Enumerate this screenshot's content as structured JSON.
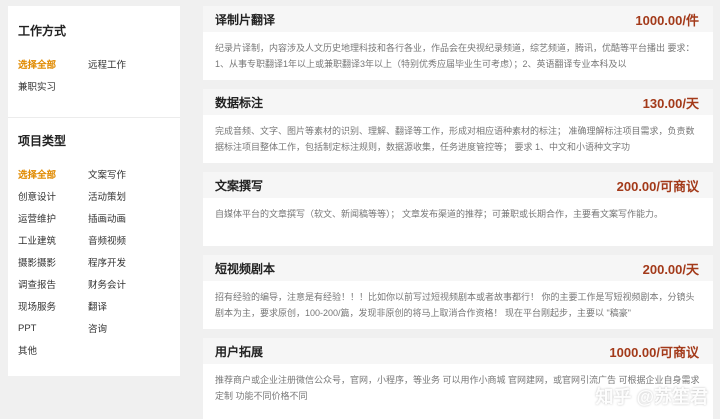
{
  "sidebar": {
    "work_mode": {
      "title": "工作方式",
      "rows": [
        [
          "选择全部",
          "远程工作"
        ],
        [
          "兼职实习"
        ]
      ]
    },
    "project_type": {
      "title": "项目类型",
      "rows": [
        [
          "选择全部",
          "文案写作"
        ],
        [
          "创意设计",
          "活动策划"
        ],
        [
          "运营维护",
          "插画动画"
        ],
        [
          "工业建筑",
          "音频视频"
        ],
        [
          "摄影摄影",
          "程序开发"
        ],
        [
          "调查报告",
          "财务会计"
        ],
        [
          "现场服务",
          "翻译"
        ],
        [
          "PPT",
          "咨询"
        ],
        [
          "其他"
        ]
      ]
    }
  },
  "jobs": [
    {
      "title": "译制片翻译",
      "price": "1000.00/件",
      "desc": "纪录片译制，内容涉及人文历史地理科技和各行各业，作品会在央视纪录频道，综艺频道，腾讯，优酷等平台播出 要求： 1、从事专职翻译1年以上或兼职翻译3年以上（特别优秀应届毕业生可考虑）；2、英语翻译专业本科及以"
    },
    {
      "title": "数据标注",
      "price": "130.00/天",
      "desc": "完成音频、文字、图片等素材的识别、理解、翻译等工作，形成对相应语种素材的标注； 准确理解标注项目需求，负责数据标注项目整体工作，包括制定标注规则，数据源收集，任务进度管控等； 要求 1、中文和小语种文字功"
    },
    {
      "title": "文案撰写",
      "price": "200.00/可商议",
      "desc": "自媒体平台的文章撰写（软文、新闻稿等等）； 文章发布渠道的推荐；可兼职或长期合作，主要看文案写作能力。"
    },
    {
      "title": "短视频剧本",
      "price": "200.00/天",
      "desc": "招有经验的编导，注意是有经验！！！比如你以前写过短视频剧本或者故事都行！ 你的主要工作是写短视频剧本，分镜头剧本为主，要求原创，100-200/篇，发现非原创的将马上取消合作资格！ 现在平台刚起步，主要以 \"稿豪\""
    },
    {
      "title": "用户拓展",
      "price": "1000.00/可商议",
      "desc": "推荐商户或企业注册微信公众号，官网，小程序，等业务 可以用作小商城 官网建网，或官网引流广告 可根据企业自身需求定制 功能不同价格不同"
    }
  ],
  "watermark": "知乎 @苏笙君",
  "colors": {
    "accent": "#e08a00",
    "price": "#a33a1a"
  }
}
